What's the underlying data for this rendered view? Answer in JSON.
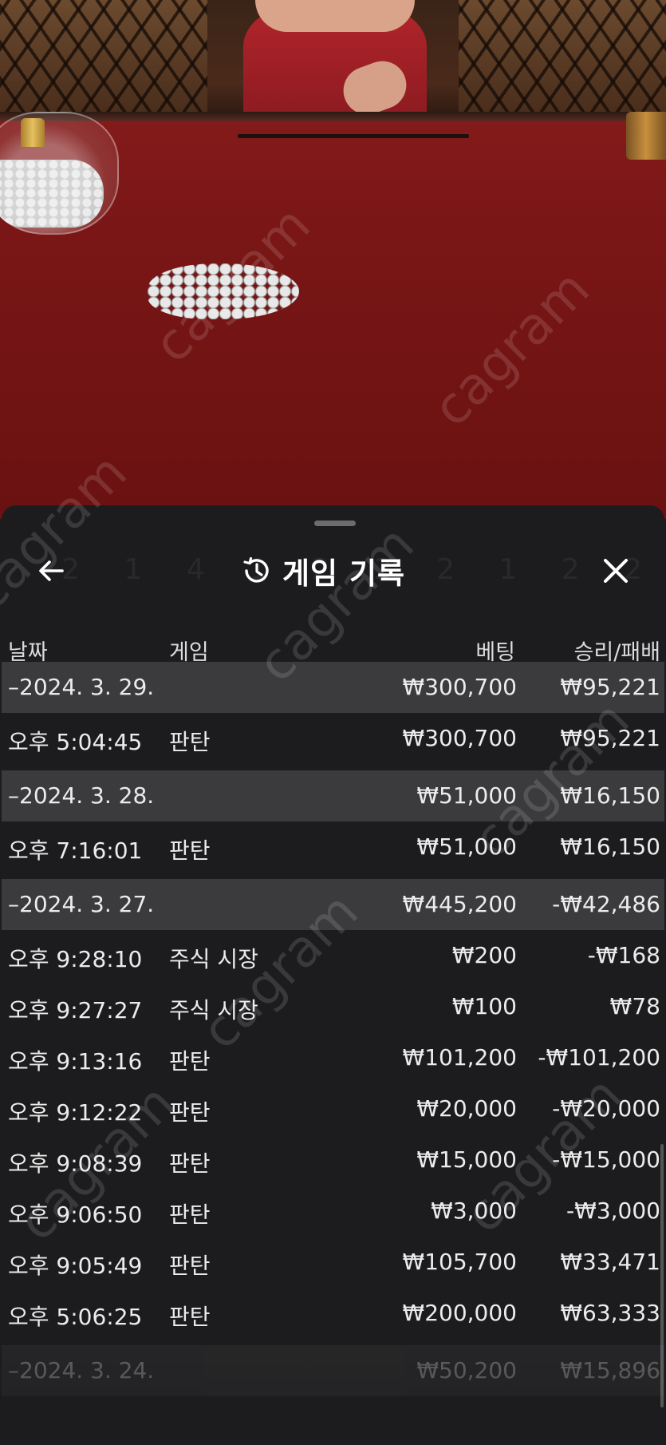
{
  "header": {
    "title": "게임 기록",
    "back_icon": "arrow-left-icon",
    "history_icon": "history-clock-icon",
    "close_icon": "close-icon",
    "background_digits": "2 1 4 1 2 2 2 1 2 2 1 2 2"
  },
  "columns": {
    "date": "날짜",
    "game": "게임",
    "bet": "베팅",
    "result": "승리/패배"
  },
  "groups": [
    {
      "date": "–2024. 3. 29.",
      "bet": "₩300,700",
      "result": "₩95,221",
      "items": [
        {
          "time": "오후 5:04:45",
          "game": "판탄",
          "bet": "₩300,700",
          "result": "₩95,221"
        }
      ]
    },
    {
      "date": "–2024. 3. 28.",
      "bet": "₩51,000",
      "result": "₩16,150",
      "items": [
        {
          "time": "오후 7:16:01",
          "game": "판탄",
          "bet": "₩51,000",
          "result": "₩16,150"
        }
      ]
    },
    {
      "date": "–2024. 3. 27.",
      "bet": "₩445,200",
      "result": "-₩42,486",
      "items": [
        {
          "time": "오후 9:28:10",
          "game": "주식 시장",
          "bet": "₩200",
          "result": "-₩168"
        },
        {
          "time": "오후 9:27:27",
          "game": "주식 시장",
          "bet": "₩100",
          "result": "₩78"
        },
        {
          "time": "오후 9:13:16",
          "game": "판탄",
          "bet": "₩101,200",
          "result": "-₩101,200"
        },
        {
          "time": "오후 9:12:22",
          "game": "판탄",
          "bet": "₩20,000",
          "result": "-₩20,000"
        },
        {
          "time": "오후 9:08:39",
          "game": "판탄",
          "bet": "₩15,000",
          "result": "-₩15,000"
        },
        {
          "time": "오후 9:06:50",
          "game": "판탄",
          "bet": "₩3,000",
          "result": "-₩3,000"
        },
        {
          "time": "오후 9:05:49",
          "game": "판탄",
          "bet": "₩105,700",
          "result": "₩33,471"
        },
        {
          "time": "오후 5:06:25",
          "game": "판탄",
          "bet": "₩200,000",
          "result": "₩63,333"
        }
      ]
    },
    {
      "date": "–2024. 3. 24.",
      "bet": "₩50,200",
      "result": "₩15,896",
      "items": []
    }
  ],
  "watermark": "cagram",
  "colors": {
    "sheet_bg": "#1c1c1e",
    "date_row_bg": "#3b3b3d",
    "text": "#ececec",
    "table_felt": "#8e1f1f"
  }
}
